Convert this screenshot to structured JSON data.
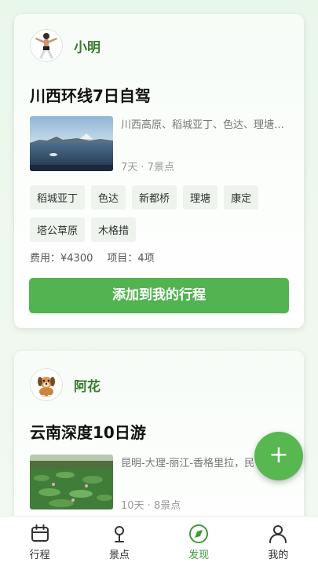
{
  "feed": [
    {
      "author": "小明",
      "title": "川西环线7日自驾",
      "description": "川西高原、稻城亚丁、色达、理塘、康定",
      "meta": "7天 · 7景点",
      "tags": [
        "稻城亚丁",
        "色达",
        "新都桥",
        "理塘",
        "康定",
        "塔公草原",
        "木格措"
      ],
      "cost": "费用：¥4300",
      "items": "项目：4项",
      "add_button": "添加到我的行程"
    },
    {
      "author": "阿花",
      "title": "云南深度10日游",
      "description": "昆明-大理-丽江-香格里拉，民",
      "meta": "10天 · 8景点"
    }
  ],
  "fab_label": "+",
  "tabbar": {
    "items": [
      {
        "label": "行程",
        "icon": "calendar-icon"
      },
      {
        "label": "景点",
        "icon": "location-pin-icon"
      },
      {
        "label": "发现",
        "icon": "compass-icon",
        "active": true
      },
      {
        "label": "我的",
        "icon": "user-icon"
      }
    ]
  },
  "colors": {
    "accent": "#52b450",
    "author_name": "#3a7a2f",
    "tab_active": "#3f9a3a"
  }
}
